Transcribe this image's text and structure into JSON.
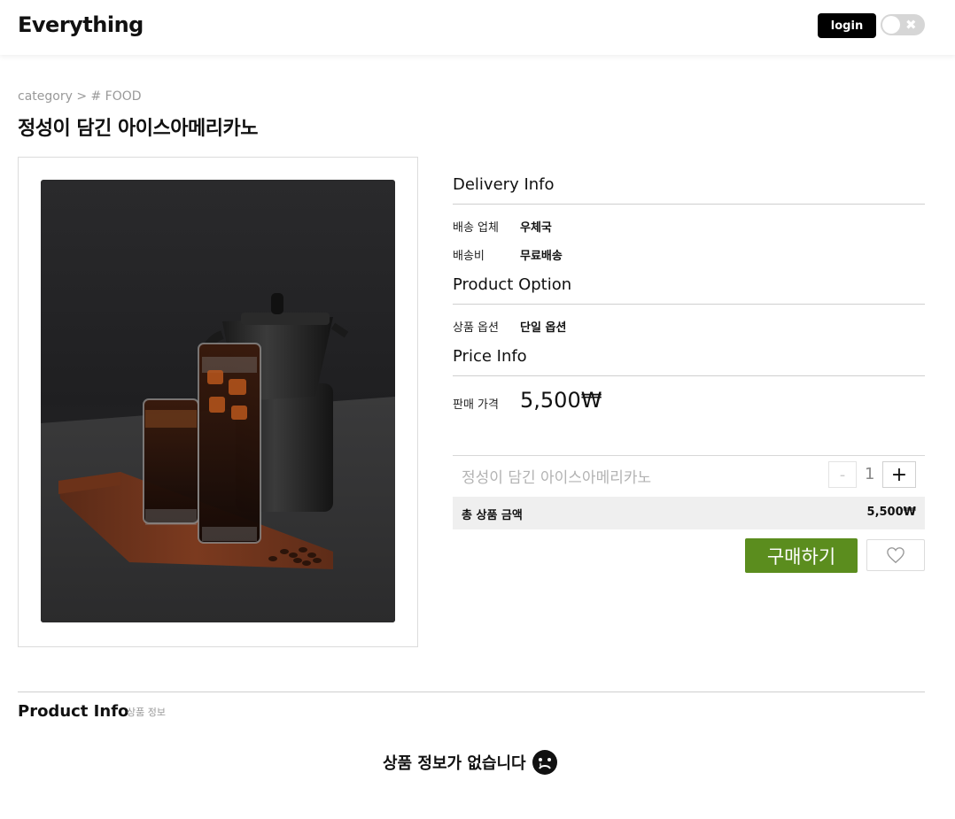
{
  "header": {
    "logo": "Everything",
    "login_label": "login",
    "toggle_icon": "close-icon"
  },
  "breadcrumb": "category > # FOOD",
  "product": {
    "title": "정성이 담긴 아이스아메리카노",
    "image_alt": "아이스아메리카노 사진"
  },
  "delivery": {
    "section_title": "Delivery Info",
    "carrier_label": "배송 업체",
    "carrier_value": "우체국",
    "fee_label": "배송비",
    "fee_value": "무료배송"
  },
  "option": {
    "section_title": "Product Option",
    "label": "상품 옵션",
    "value": "단일 옵션"
  },
  "price": {
    "section_title": "Price Info",
    "label": "판매 가격",
    "value": "5,500₩"
  },
  "selected": {
    "name": "정성이 담긴 아이스아메리카노",
    "minus": "-",
    "quantity": "1",
    "plus": "+"
  },
  "total": {
    "label": "총 상품 금액",
    "value": "5,500₩"
  },
  "actions": {
    "buy_label": "구매하기",
    "like_icon": "heart-icon"
  },
  "product_info": {
    "title": "Product Info",
    "subtitle": "상품 정보",
    "empty_message": "상품 정보가 없습니다",
    "empty_icon": "sad-face-icon"
  },
  "colors": {
    "accent_green": "#5b8d1e",
    "login_bg": "#000000",
    "total_bg": "#efefef"
  }
}
